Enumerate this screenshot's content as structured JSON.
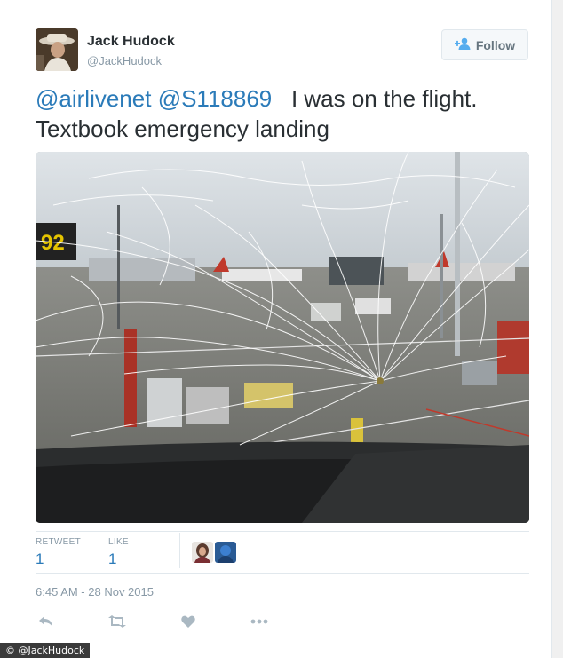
{
  "user": {
    "name": "Jack Hudock",
    "handle": "@JackHudock"
  },
  "follow_button": {
    "label": "Follow",
    "icon": "add-user-icon"
  },
  "tweet": {
    "mention_1": "@airlivenet",
    "mention_2": "@S118869",
    "text": "I was on the flight. Textbook emergency landing"
  },
  "photo": {
    "gate_sign": "92"
  },
  "stats": {
    "retweet_label": "RETWEET",
    "retweet_count": "1",
    "like_label": "LIKE",
    "like_count": "1"
  },
  "timestamp": "6:45 AM - 28 Nov 2015",
  "actions": {
    "reply_icon": "reply-icon",
    "retweet_icon": "retweet-icon",
    "like_icon": "heart-icon",
    "more_icon": "more-icon"
  },
  "credit": "© @JackHudock",
  "colors": {
    "link": "#2b7bb9",
    "muted": "#8899a6",
    "text": "#292f33",
    "border": "#e1e8ed"
  }
}
